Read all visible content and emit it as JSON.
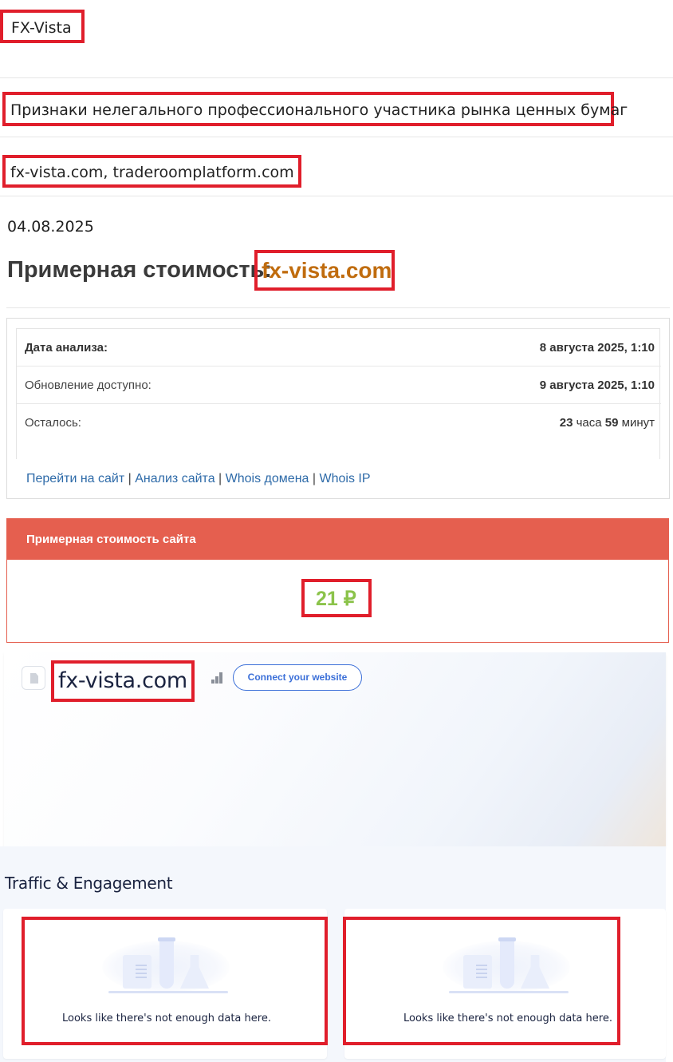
{
  "brand": "FX-Vista",
  "heading": "Признаки нелегального профессионального участника рынка ценных бумаг",
  "domains": "fx-vista.com, traderoomplatform.com",
  "date": "04.08.2025",
  "estimated_cost": {
    "label": "Примерная стоимость:",
    "domain": "fx-vista.com"
  },
  "analysis": {
    "rows": [
      {
        "key": "Дата анализа:",
        "value": "8 августа 2025, 1:10"
      },
      {
        "key": "Обновление доступно:",
        "value": "9 августа 2025, 1:10"
      },
      {
        "key": "Осталось:",
        "value_hours": "23",
        "value_hours_unit": "часа",
        "value_minutes": "59",
        "value_minutes_unit": "минут"
      }
    ],
    "links": [
      "Перейти на сайт",
      "Анализ сайта",
      "Whois домена",
      "Whois IP"
    ],
    "separator": "|"
  },
  "site_value": {
    "title": "Примерная стоимость сайта",
    "amount": "21 ₽"
  },
  "widget": {
    "site": "fx-vista.com",
    "connect_label": "Connect your website"
  },
  "traffic": {
    "title": "Traffic & Engagement",
    "cards": [
      {
        "empty_text": "Looks like there's not enough data here."
      },
      {
        "empty_text": "Looks like there's not enough data here."
      }
    ]
  },
  "colors": {
    "highlight_box": "#e01e2b",
    "panel_header": "#e55f4f",
    "amount": "#8bc34a",
    "domain_highlight": "#c06c0e",
    "link": "#2d6aa8",
    "button": "#3b6fd8"
  }
}
